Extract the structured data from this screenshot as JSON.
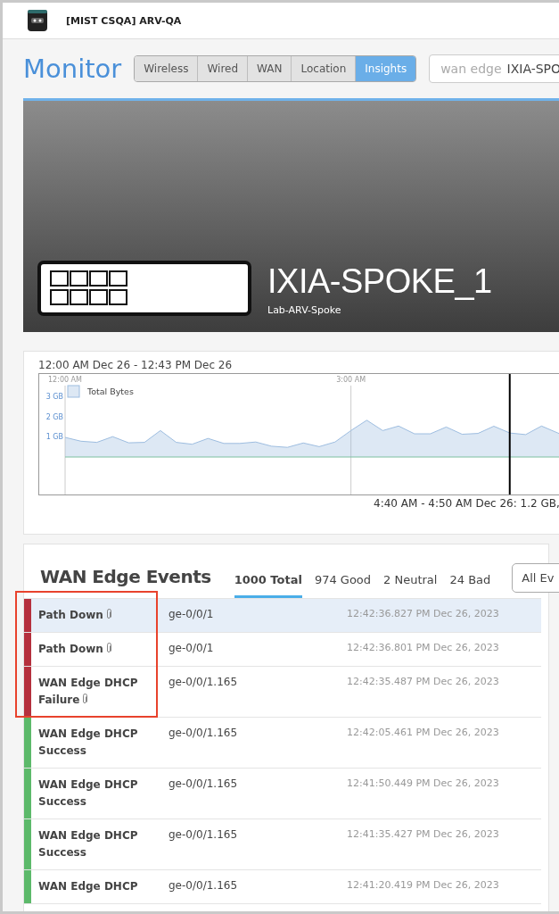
{
  "header": {
    "org_title": "[MIST CSQA] ARV-QA"
  },
  "page": {
    "title": "Monitor"
  },
  "tabs": [
    {
      "label": "Wireless",
      "selected": false
    },
    {
      "label": "Wired",
      "selected": false
    },
    {
      "label": "WAN",
      "selected": false
    },
    {
      "label": "Location",
      "selected": false
    },
    {
      "label": "Insights",
      "selected": true
    }
  ],
  "search": {
    "placeholder": "wan edge",
    "value": "IXIA-SPO"
  },
  "device": {
    "name": "IXIA-SPOKE_1",
    "site": "Lab-ARV-Spoke"
  },
  "traffic": {
    "chart_data": {
      "type": "area",
      "title": "12:00 AM Dec 26 - 12:43 PM Dec 26",
      "x": [
        0,
        10,
        20,
        30,
        40,
        50,
        60,
        70,
        80,
        90,
        100,
        110,
        120,
        130,
        140,
        150,
        160,
        170,
        180,
        190,
        200,
        210,
        220,
        230,
        240,
        250,
        260,
        270,
        280,
        290,
        300,
        310,
        320
      ],
      "series": [
        {
          "name": "Total Bytes",
          "color": "#9dbde0",
          "values": [
            0.98,
            0.79,
            0.73,
            1.02,
            0.71,
            0.73,
            1.32,
            0.73,
            0.64,
            0.93,
            0.68,
            0.68,
            0.75,
            0.54,
            0.48,
            0.7,
            0.52,
            0.75,
            1.32,
            1.84,
            1.32,
            1.55,
            1.16,
            1.16,
            1.5,
            1.14,
            1.18,
            1.54,
            1.2,
            1.12,
            1.55,
            1.21,
            0.88
          ]
        }
      ],
      "xticks": [
        {
          "value": 0,
          "label": "12:00 AM"
        },
        {
          "value": 180,
          "label": "3:00 AM"
        }
      ],
      "yticks": [
        {
          "value": 1,
          "label": "1 GB"
        },
        {
          "value": 2,
          "label": "2 GB"
        },
        {
          "value": 3,
          "label": "3 GB"
        }
      ],
      "xlim": [
        0,
        320
      ],
      "ylim": [
        -1.875,
        4
      ],
      "ref_lines": [
        {
          "axis": "y",
          "value": 0,
          "color": "#7cc0a0"
        },
        {
          "axis": "x",
          "value": 280,
          "color": "#000000"
        }
      ]
    },
    "tooltip": "4:40 AM - 4:50 AM Dec 26: 1.2 GB,"
  },
  "events": {
    "title": "WAN Edge Events",
    "filters": [
      {
        "label": "1000 Total",
        "selected": true
      },
      {
        "label": "974 Good",
        "selected": false
      },
      {
        "label": "2 Neutral",
        "selected": false
      },
      {
        "label": "24 Bad",
        "selected": false
      }
    ],
    "dropdown": "All Ev",
    "rows": [
      {
        "name": "Path Down",
        "attachment": true,
        "port": "ge-0/0/1",
        "time": "12:42:36.827 PM Dec 26, 2023",
        "color": "#b5303d",
        "selected": true
      },
      {
        "name": "Path Down",
        "attachment": true,
        "port": "ge-0/0/1",
        "time": "12:42:36.801 PM Dec 26, 2023",
        "color": "#b5303d",
        "selected": false
      },
      {
        "name": "WAN Edge DHCP Failure",
        "attachment": true,
        "port": "ge-0/0/1.165",
        "time": "12:42:35.487 PM Dec 26, 2023",
        "color": "#b5303d",
        "selected": false
      },
      {
        "name": "WAN Edge DHCP Success",
        "attachment": false,
        "port": "ge-0/0/1.165",
        "time": "12:42:05.461 PM Dec 26, 2023",
        "color": "#5cb96a",
        "selected": false
      },
      {
        "name": "WAN Edge DHCP Success",
        "attachment": false,
        "port": "ge-0/0/1.165",
        "time": "12:41:50.449 PM Dec 26, 2023",
        "color": "#5cb96a",
        "selected": false
      },
      {
        "name": "WAN Edge DHCP Success",
        "attachment": false,
        "port": "ge-0/0/1.165",
        "time": "12:41:35.427 PM Dec 26, 2023",
        "color": "#5cb96a",
        "selected": false
      },
      {
        "name": "WAN Edge DHCP",
        "attachment": false,
        "port": "ge-0/0/1.165",
        "time": "12:41:20.419 PM Dec 26, 2023",
        "color": "#5cb96a",
        "selected": false
      }
    ]
  }
}
